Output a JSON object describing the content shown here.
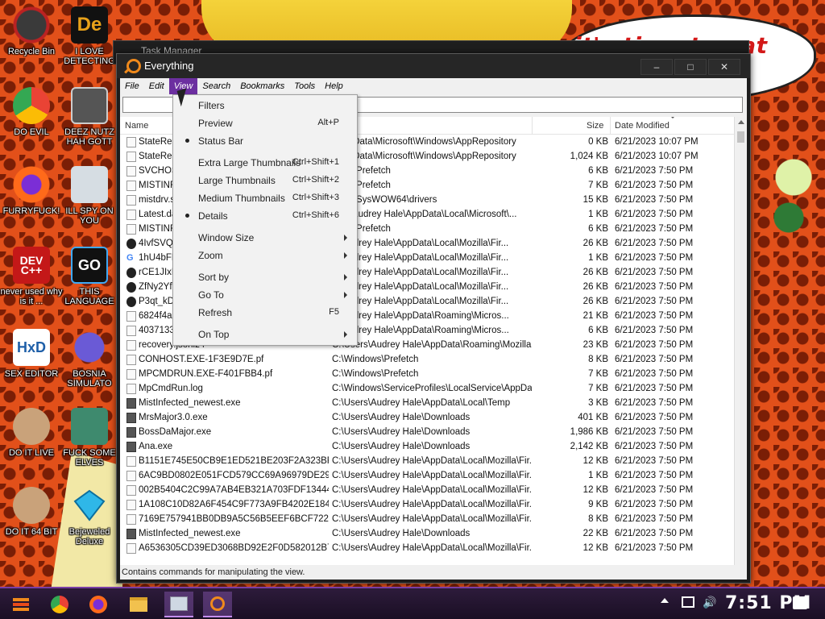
{
  "desktop": {
    "icons": [
      {
        "label": "Recycle Bin"
      },
      {
        "label": "I LOVE DETECTING"
      },
      {
        "label": "DO EVIL"
      },
      {
        "label": "DEEZ NUTZ HAH GOTT"
      },
      {
        "label": "FURRYFUCK!"
      },
      {
        "label": "ILL SPY ON YOU"
      },
      {
        "label": "never used why is it ..."
      },
      {
        "label": "THIS LANGUAGE"
      },
      {
        "label": "SEX EDITOR"
      },
      {
        "label": "BOSNIA SIMULATO"
      },
      {
        "label": "DO IT LIVE"
      },
      {
        "label": "FUCK SOME ELVES"
      },
      {
        "label": "DO IT 64 BIT"
      },
      {
        "label": "Bejeweled Deluxe"
      }
    ],
    "speech_text": "it's time to eat shit w",
    "bg_window_title": "Task Manager"
  },
  "window": {
    "title": "Everything",
    "menu": [
      "File",
      "Edit",
      "View",
      "Search",
      "Bookmarks",
      "Tools",
      "Help"
    ],
    "search_value": "",
    "columns": {
      "name": "Name",
      "size": "Size",
      "date": "Date Modified"
    },
    "rows": [
      {
        "icon": "file",
        "name": "StateRep",
        "path": "gramData\\Microsoft\\Windows\\AppRepository",
        "size": "0 KB",
        "date": "6/21/2023 10:07 PM"
      },
      {
        "icon": "file",
        "name": "StateRep",
        "path": "gramData\\Microsoft\\Windows\\AppRepository",
        "size": "1,024 KB",
        "date": "6/21/2023 10:07 PM"
      },
      {
        "icon": "file",
        "name": "SVCHOST",
        "path": "dows\\Prefetch",
        "size": "6 KB",
        "date": "6/21/2023 7:50 PM"
      },
      {
        "icon": "file",
        "name": "MISTINFE",
        "path": "dows\\Prefetch",
        "size": "7 KB",
        "date": "6/21/2023 7:50 PM"
      },
      {
        "icon": "file",
        "name": "mistdrv.s",
        "path": "dows\\SysWOW64\\drivers",
        "size": "15 KB",
        "date": "6/21/2023 7:50 PM"
      },
      {
        "icon": "file",
        "name": "Latest.da",
        "path": "sers\\Audrey Hale\\AppData\\Local\\Microsoft\\...",
        "size": "1 KB",
        "date": "6/21/2023 7:50 PM"
      },
      {
        "icon": "file",
        "name": "MISTINFE",
        "path": "dows\\Prefetch",
        "size": "6 KB",
        "date": "6/21/2023 7:50 PM"
      },
      {
        "icon": "gh",
        "name": "4IvfSVQs",
        "path": "rs\\Audrey Hale\\AppData\\Local\\Mozilla\\Fir...",
        "size": "26 KB",
        "date": "6/21/2023 7:50 PM"
      },
      {
        "icon": "g",
        "name": "1hU4bFFi",
        "path": "rs\\Audrey Hale\\AppData\\Local\\Mozilla\\Fir...",
        "size": "1 KB",
        "date": "6/21/2023 7:50 PM"
      },
      {
        "icon": "gh",
        "name": "rCE1JIxB",
        "path": "rs\\Audrey Hale\\AppData\\Local\\Mozilla\\Fir...",
        "size": "26 KB",
        "date": "6/21/2023 7:50 PM"
      },
      {
        "icon": "gh",
        "name": "ZfNy2YfW",
        "path": "rs\\Audrey Hale\\AppData\\Local\\Mozilla\\Fir...",
        "size": "26 KB",
        "date": "6/21/2023 7:50 PM"
      },
      {
        "icon": "gh",
        "name": "P3qt_kD5",
        "path": "rs\\Audrey Hale\\AppData\\Local\\Mozilla\\Fir...",
        "size": "26 KB",
        "date": "6/21/2023 7:50 PM"
      },
      {
        "icon": "file",
        "name": "6824f4a9",
        "path": "rs\\Audrey Hale\\AppData\\Roaming\\Micros...",
        "size": "21 KB",
        "date": "6/21/2023 7:50 PM"
      },
      {
        "icon": "file",
        "name": "4037133",
        "path": "rs\\Audrey Hale\\AppData\\Roaming\\Micros...",
        "size": "6 KB",
        "date": "6/21/2023 7:50 PM"
      },
      {
        "icon": "file",
        "name": "recovery.jsonlz4",
        "path": "C:\\Users\\Audrey Hale\\AppData\\Roaming\\Mozilla...",
        "size": "23 KB",
        "date": "6/21/2023 7:50 PM"
      },
      {
        "icon": "file",
        "name": "CONHOST.EXE-1F3E9D7E.pf",
        "path": "C:\\Windows\\Prefetch",
        "size": "8 KB",
        "date": "6/21/2023 7:50 PM"
      },
      {
        "icon": "file",
        "name": "MPCMDRUN.EXE-F401FBB4.pf",
        "path": "C:\\Windows\\Prefetch",
        "size": "7 KB",
        "date": "6/21/2023 7:50 PM"
      },
      {
        "icon": "file",
        "name": "MpCmdRun.log",
        "path": "C:\\Windows\\ServiceProfiles\\LocalService\\AppDat...",
        "size": "7 KB",
        "date": "6/21/2023 7:50 PM"
      },
      {
        "icon": "exe",
        "name": "MistInfected_newest.exe",
        "path": "C:\\Users\\Audrey Hale\\AppData\\Local\\Temp",
        "size": "3 KB",
        "date": "6/21/2023 7:50 PM"
      },
      {
        "icon": "exe",
        "name": "MrsMajor3.0.exe",
        "path": "C:\\Users\\Audrey Hale\\Downloads",
        "size": "401 KB",
        "date": "6/21/2023 7:50 PM"
      },
      {
        "icon": "exe",
        "name": "BossDaMajor.exe",
        "path": "C:\\Users\\Audrey Hale\\Downloads",
        "size": "1,986 KB",
        "date": "6/21/2023 7:50 PM"
      },
      {
        "icon": "exe",
        "name": "Ana.exe",
        "path": "C:\\Users\\Audrey Hale\\Downloads",
        "size": "2,142 KB",
        "date": "6/21/2023 7:50 PM"
      },
      {
        "icon": "file",
        "name": "B1151E745E50CB9E1ED521BE203F2A323BF...",
        "path": "C:\\Users\\Audrey Hale\\AppData\\Local\\Mozilla\\Fir...",
        "size": "12 KB",
        "date": "6/21/2023 7:50 PM"
      },
      {
        "icon": "file",
        "name": "6AC9BD0802E051FCD579CC69A96979DE296...",
        "path": "C:\\Users\\Audrey Hale\\AppData\\Local\\Mozilla\\Fir...",
        "size": "1 KB",
        "date": "6/21/2023 7:50 PM"
      },
      {
        "icon": "file",
        "name": "002B5404C2C99A7AB4EB321A703FDF13444...",
        "path": "C:\\Users\\Audrey Hale\\AppData\\Local\\Mozilla\\Fir...",
        "size": "12 KB",
        "date": "6/21/2023 7:50 PM"
      },
      {
        "icon": "file",
        "name": "1A108C10D82A6F454C9F773A9FB4202E184D...",
        "path": "C:\\Users\\Audrey Hale\\AppData\\Local\\Mozilla\\Fir...",
        "size": "9 KB",
        "date": "6/21/2023 7:50 PM"
      },
      {
        "icon": "file",
        "name": "7169E757941BB0DB9A5C56B5EEF6BCF722E...",
        "path": "C:\\Users\\Audrey Hale\\AppData\\Local\\Mozilla\\Fir...",
        "size": "8 KB",
        "date": "6/21/2023 7:50 PM"
      },
      {
        "icon": "exe",
        "name": "MistInfected_newest.exe",
        "path": "C:\\Users\\Audrey Hale\\Downloads",
        "size": "22 KB",
        "date": "6/21/2023 7:50 PM"
      },
      {
        "icon": "file",
        "name": "A6536305CD39ED3068BD92E2F0D582012B7...",
        "path": "C:\\Users\\Audrey Hale\\AppData\\Local\\Mozilla\\Fir...",
        "size": "12 KB",
        "date": "6/21/2023 7:50 PM"
      }
    ],
    "status_text": "Contains commands for manipulating the view."
  },
  "view_menu": {
    "items": [
      {
        "label": "Filters",
        "shortcut": "",
        "bullet": false,
        "submenu": false
      },
      {
        "label": "Preview",
        "shortcut": "Alt+P",
        "bullet": false,
        "submenu": false
      },
      {
        "label": "Status Bar",
        "shortcut": "",
        "bullet": true,
        "submenu": false
      },
      {
        "label": "Extra Large Thumbnails",
        "shortcut": "Ctrl+Shift+1",
        "bullet": false,
        "submenu": false
      },
      {
        "label": "Large Thumbnails",
        "shortcut": "Ctrl+Shift+2",
        "bullet": false,
        "submenu": false
      },
      {
        "label": "Medium Thumbnails",
        "shortcut": "Ctrl+Shift+3",
        "bullet": false,
        "submenu": false
      },
      {
        "label": "Details",
        "shortcut": "Ctrl+Shift+6",
        "bullet": true,
        "submenu": false
      },
      {
        "label": "Window Size",
        "shortcut": "",
        "bullet": false,
        "submenu": true
      },
      {
        "label": "Zoom",
        "shortcut": "",
        "bullet": false,
        "submenu": true
      },
      {
        "label": "Sort by",
        "shortcut": "",
        "bullet": false,
        "submenu": true
      },
      {
        "label": "Go To",
        "shortcut": "",
        "bullet": false,
        "submenu": true
      },
      {
        "label": "Refresh",
        "shortcut": "F5",
        "bullet": false,
        "submenu": false
      },
      {
        "label": "On Top",
        "shortcut": "",
        "bullet": false,
        "submenu": true
      }
    ]
  },
  "taskbar": {
    "clock": "7:51 PM",
    "apps": [
      "start-icon",
      "chrome-icon",
      "firefox-icon",
      "file-explorer-icon",
      "task-manager-icon",
      "everything-icon"
    ]
  },
  "colors": {
    "accent": "#6c2fa0",
    "everything_orange": "#f08a1c",
    "taskbar": "#2d1b3b"
  }
}
